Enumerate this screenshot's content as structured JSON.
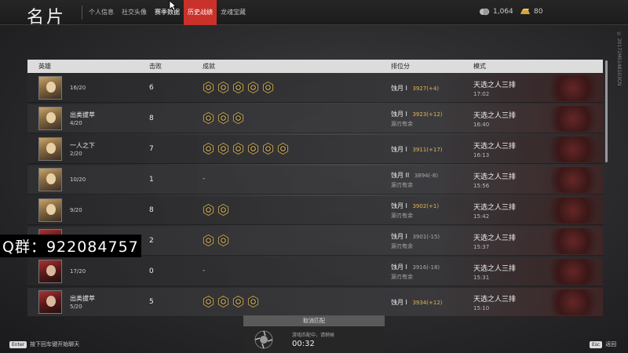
{
  "header": {
    "title": "名片",
    "tabs": [
      {
        "label": "个人信息"
      },
      {
        "label": "社交头像"
      },
      {
        "label": "赛季数据"
      },
      {
        "label": "历史战绩"
      },
      {
        "label": "龙魂宝藏"
      }
    ],
    "currency": [
      {
        "icon": "silver-coin-icon",
        "amount": "1,064"
      },
      {
        "icon": "gold-bar-icon",
        "amount": "80"
      }
    ]
  },
  "table": {
    "headers": {
      "hero": "英雄",
      "kills": "击败",
      "achievements": "成就",
      "rank": "排位分",
      "mode": "模式"
    },
    "rows": [
      {
        "title": "",
        "rank_pos": "16/20",
        "kills": "6",
        "achievements": 5,
        "tier": "蚀月 I",
        "tier_sub": "",
        "score": "3927(+4)",
        "mode": "天选之人三排",
        "time": "17:02"
      },
      {
        "title": "出类拔萃",
        "rank_pos": "4/20",
        "kills": "8",
        "achievements": 3,
        "tier": "蚀月 I",
        "tier_sub": "源刃有余",
        "score": "3923(+12)",
        "mode": "天选之人三排",
        "time": "16:40"
      },
      {
        "title": "一人之下",
        "rank_pos": "2/20",
        "kills": "7",
        "achievements": 6,
        "tier": "蚀月 I",
        "tier_sub": "",
        "score": "3911(+17)",
        "mode": "天选之人三排",
        "time": "16:13"
      },
      {
        "title": "",
        "rank_pos": "10/20",
        "kills": "1",
        "achievements": 0,
        "tier": "蚀月 II",
        "tier_sub": "源刃有余",
        "score": "3894(-8)",
        "mode": "天选之人三排",
        "time": "15:56"
      },
      {
        "title": "",
        "rank_pos": "9/20",
        "kills": "8",
        "achievements": 2,
        "tier": "蚀月 I",
        "tier_sub": "源刃有余",
        "score": "3902(+1)",
        "mode": "天选之人三排",
        "time": "15:42"
      },
      {
        "title": "",
        "rank_pos": "",
        "kills": "2",
        "achievements": 2,
        "tier": "蚀月 I",
        "tier_sub": "源刃有余",
        "score": "3901(-15)",
        "mode": "天选之人三排",
        "time": "15:37"
      },
      {
        "title": "",
        "rank_pos": "17/20",
        "kills": "0",
        "achievements": 0,
        "tier": "蚀月 I",
        "tier_sub": "源刃有余",
        "score": "3916(-18)",
        "mode": "天选之人三排",
        "time": "15:31"
      },
      {
        "title": "出类拔萃",
        "rank_pos": "5/20",
        "kills": "5",
        "achievements": 4,
        "tier": "蚀月 I",
        "tier_sub": "",
        "score": "3934(+12)",
        "mode": "天选之人三排",
        "time": "15:10"
      }
    ],
    "empty_achievement": "-"
  },
  "overlay": {
    "qq_text": "Q群：922084757"
  },
  "matchmaking": {
    "cancel_label": "取消匹配",
    "status": "游戏匹配中，请稍候",
    "timer": "00:32"
  },
  "footer": {
    "enter_key": "Enter",
    "enter_label": "按下回车键开始聊天",
    "esc_key": "Esc",
    "esc_label": "返回"
  },
  "side_code": "© 20171MS1481G3CN"
}
